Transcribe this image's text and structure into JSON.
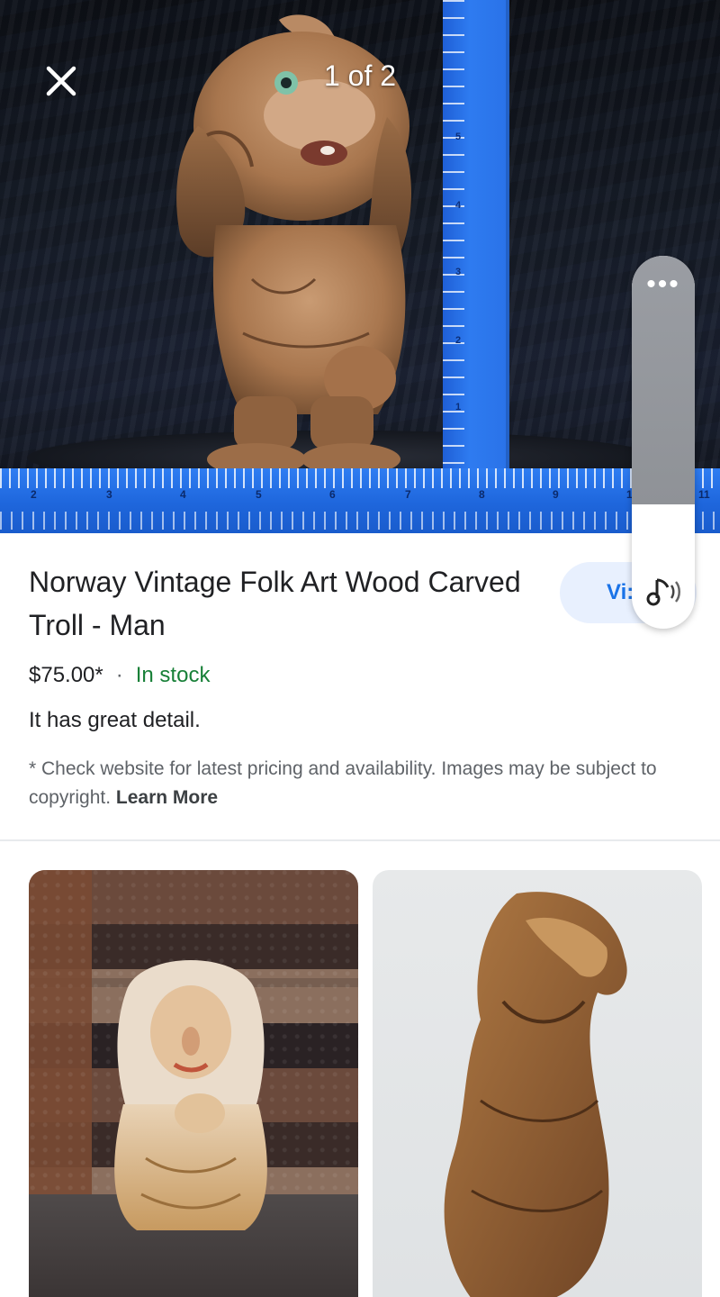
{
  "viewer": {
    "counter": "1 of 2",
    "close_icon": "close-icon",
    "more_icon": "more-horizontal-icon",
    "music_icon": "music-note-icon",
    "more_label": "•••",
    "ruler_h_numbers": [
      "2",
      "3",
      "4",
      "5",
      "6",
      "7",
      "8",
      "9",
      "1",
      "11"
    ],
    "ruler_v_numbers": [
      "5",
      "4",
      "3",
      "2",
      "1"
    ]
  },
  "product": {
    "title": "Norway Vintage Folk Art Wood Carved Troll - Man",
    "visit_label": "Vi:",
    "price": "$75.00*",
    "separator": "·",
    "stock": "In stock",
    "description": "It has great detail.",
    "disclaimer": "* Check website for latest pricing and availability. Images may be subject to copyright.",
    "learn_more": "Learn More",
    "colors": {
      "stock_green": "#188038",
      "accent_blue": "#1a73e8",
      "text_primary": "#202124",
      "text_secondary": "#5f6368"
    }
  },
  "related": {
    "items": [
      {
        "icon": "wood-carving-woman-image"
      },
      {
        "icon": "wood-carving-figure-image"
      }
    ]
  }
}
